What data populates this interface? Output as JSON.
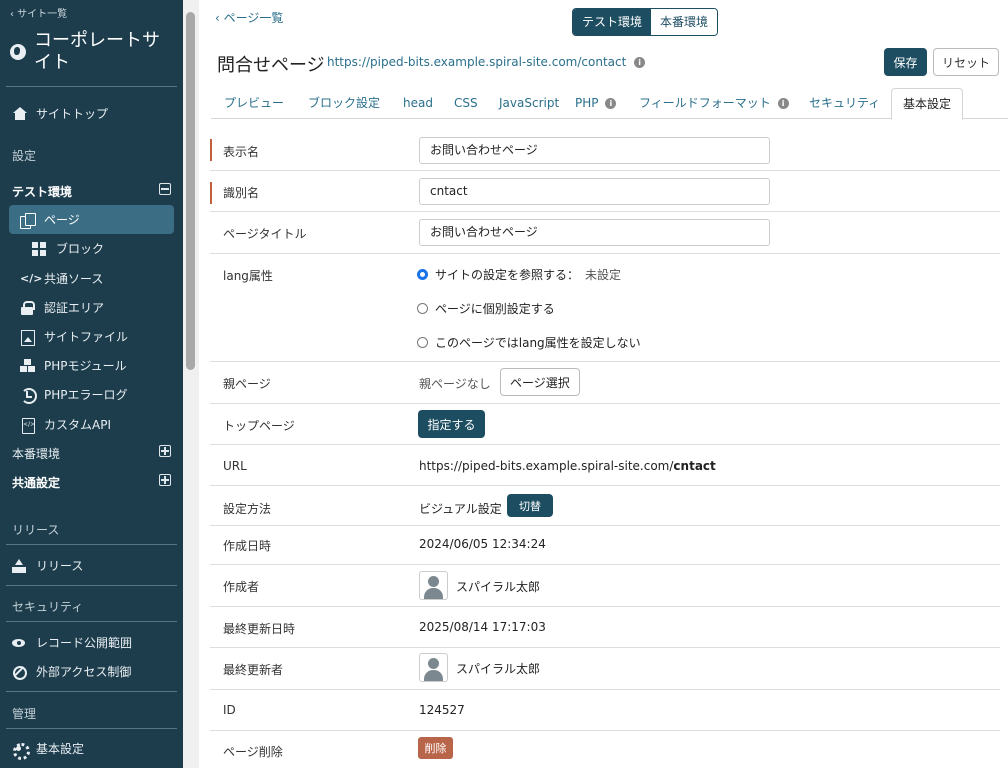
{
  "sidebar": {
    "back_label": "‹ サイト一覧",
    "site_name": "コーポレートサイト",
    "site_top": "サイトトップ",
    "section_settings": "設定",
    "test_env": "テスト環境",
    "items": [
      {
        "label": "ページ",
        "icon": "pages-icon"
      },
      {
        "label": "ブロック",
        "icon": "blocks-icon"
      },
      {
        "label": "共通ソース",
        "icon": "code-icon"
      },
      {
        "label": "認証エリア",
        "icon": "lock-icon"
      },
      {
        "label": "サイトファイル",
        "icon": "image-icon"
      },
      {
        "label": "PHPモジュール",
        "icon": "cubes-icon"
      },
      {
        "label": "PHPエラーログ",
        "icon": "history-icon"
      },
      {
        "label": "カスタムAPI",
        "icon": "file-code-icon"
      }
    ],
    "prod_env": "本番環境",
    "common_settings": "共通設定",
    "section_release": "リリース",
    "release": "リリース",
    "section_security": "セキュリティ",
    "record_scope": "レコード公開範囲",
    "external_access": "外部アクセス制御",
    "section_admin": "管理",
    "basic_settings": "基本設定"
  },
  "header": {
    "back_link": "‹  ページ一覧",
    "env_test": "テスト環境",
    "env_prod": "本番環境",
    "title": "問合せページ",
    "url": "https://piped-bits.example.spiral-site.com/contact",
    "info_glyph": "i",
    "save": "保存",
    "reset": "リセット"
  },
  "tabs": [
    {
      "label": "プレビュー"
    },
    {
      "label": "ブロック設定"
    },
    {
      "label": "head"
    },
    {
      "label": "CSS"
    },
    {
      "label": "JavaScript"
    },
    {
      "label": "PHP"
    },
    {
      "label": "フィールドフォーマット"
    },
    {
      "label": "セキュリティ"
    },
    {
      "label": "基本設定"
    }
  ],
  "form": {
    "display_name": {
      "label": "表示名",
      "value": "お問い合わせページ"
    },
    "identifier": {
      "label": "識別名",
      "value": "cntact"
    },
    "page_title": {
      "label": "ページタイトル",
      "value": "お問い合わせページ"
    },
    "lang": {
      "label": "lang属性",
      "opt1": "サイトの設定を参照する：",
      "opt1_value": "未設定",
      "opt2": "ページに個別設定する",
      "opt3": "このページではlang属性を設定しない"
    },
    "parent": {
      "label": "親ページ",
      "value": "親ページなし",
      "button": "ページ選択"
    },
    "top_page": {
      "label": "トップページ",
      "button": "指定する"
    },
    "url": {
      "label": "URL",
      "prefix": "https://piped-bits.example.spiral-site.com/",
      "slug": "cntact"
    },
    "method": {
      "label": "設定方法",
      "value": "ビジュアル設定",
      "button": "切替"
    },
    "created_at": {
      "label": "作成日時",
      "value": "2024/06/05 12:34:24"
    },
    "created_by": {
      "label": "作成者",
      "value": "スパイラル太郎"
    },
    "updated_at": {
      "label": "最終更新日時",
      "value": "2025/08/14 17:17:03"
    },
    "updated_by": {
      "label": "最終更新者",
      "value": "スパイラル太郎"
    },
    "id": {
      "label": "ID",
      "value": "124527"
    },
    "delete": {
      "label": "ページ削除",
      "button": "削除"
    }
  }
}
